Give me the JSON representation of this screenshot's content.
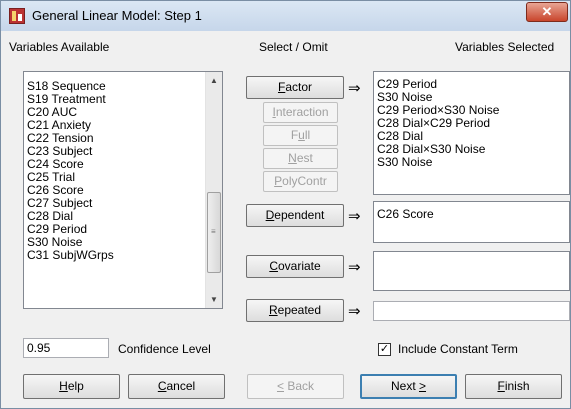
{
  "window": {
    "title": "General Linear Model: Step 1",
    "close_symbol": "✕"
  },
  "labels": {
    "variables_available": "Variables Available",
    "select_omit": "Select / Omit",
    "variables_selected": "Variables Selected",
    "confidence_level": "Confidence Level",
    "include_constant": "Include Constant Term"
  },
  "available_variables": [
    "S18 Sequence",
    "S19 Treatment",
    "C20 AUC",
    "C21 Anxiety",
    "C22 Tension",
    "C23 Subject",
    "C24 Score",
    "C25 Trial",
    "C26 Score",
    "C27 Subject",
    "C28 Dial",
    "C29 Period",
    "S30 Noise",
    "C31 SubjWGrps"
  ],
  "select_buttons": {
    "factor": {
      "prefix": "",
      "underline": "F",
      "rest": "actor"
    },
    "interaction": {
      "prefix": "",
      "underline": "I",
      "rest": "nteraction"
    },
    "full": {
      "prefix": "F",
      "underline": "u",
      "rest": "ll"
    },
    "nest": {
      "prefix": "",
      "underline": "N",
      "rest": "est"
    },
    "polycontr": {
      "prefix": "",
      "underline": "P",
      "rest": "olyContr"
    },
    "dependent": {
      "prefix": "",
      "underline": "D",
      "rest": "ependent"
    },
    "covariate": {
      "prefix": "",
      "underline": "C",
      "rest": "ovariate"
    },
    "repeated": {
      "prefix": "",
      "underline": "R",
      "rest": "epeated"
    }
  },
  "arrow_symbol": "⇒",
  "factor_selected": [
    "C29 Period",
    "S30 Noise",
    "C29 Period×S30 Noise",
    "C28 Dial×C29 Period",
    "C28 Dial",
    "C28 Dial×S30 Noise",
    "S30 Noise"
  ],
  "dependent_selected": [
    "C26 Score"
  ],
  "covariate_selected": [],
  "repeated_value": "",
  "confidence_value": "0.95",
  "include_constant_checked": true,
  "checkmark": "✓",
  "bottom_buttons": {
    "help": {
      "prefix": "",
      "underline": "H",
      "rest": "elp"
    },
    "cancel": {
      "prefix": "",
      "underline": "C",
      "rest": "ancel"
    },
    "back": {
      "prefix": "",
      "underline": "<",
      "rest": " Back"
    },
    "next": {
      "prefix": "Next ",
      "underline": ">",
      "rest": ""
    },
    "finish": {
      "prefix": "",
      "underline": "F",
      "rest": "inish"
    }
  },
  "scroll": {
    "up": "▲",
    "down": "▼",
    "grip": "≡"
  }
}
